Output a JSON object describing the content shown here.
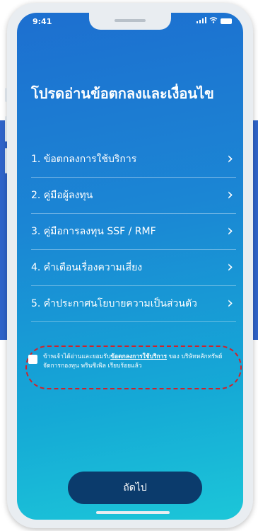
{
  "status_bar": {
    "time": "9:41",
    "signal_icon": "signal-icon",
    "wifi_icon": "wifi-icon",
    "battery_icon": "battery-icon"
  },
  "page": {
    "title": "โปรดอ่านข้อตกลงและเงื่อนไข"
  },
  "menu": {
    "items": [
      {
        "label": "1. ข้อตกลงการใช้บริการ",
        "icon": "chevron-right-icon"
      },
      {
        "label": "2. คู่มือผู้ลงทุน",
        "icon": "chevron-right-icon"
      },
      {
        "label": "3. คู่มือการลงทุน SSF / RMF",
        "icon": "chevron-right-icon"
      },
      {
        "label": "4. คำเตือนเรื่องความเสี่ยง",
        "icon": "chevron-right-icon"
      },
      {
        "label": "5. คำประกาศนโยบายความเป็นส่วนตัว",
        "icon": "chevron-right-icon"
      }
    ]
  },
  "consent": {
    "prefix": "ข้าพเจ้าได้อ่านและยอมรับ",
    "link": "ข้อตกลงการใช้บริการ",
    "suffix": " ของ บริษัทหลักทรัพย์จัดการกองทุน พรินซิเพิล เรียบร้อยแล้ว",
    "checked": false
  },
  "actions": {
    "next_label": "ถัดไป"
  },
  "colors": {
    "accent": "#1b86d4",
    "button": "#0b3b6c",
    "highlight": "#d0222a"
  }
}
